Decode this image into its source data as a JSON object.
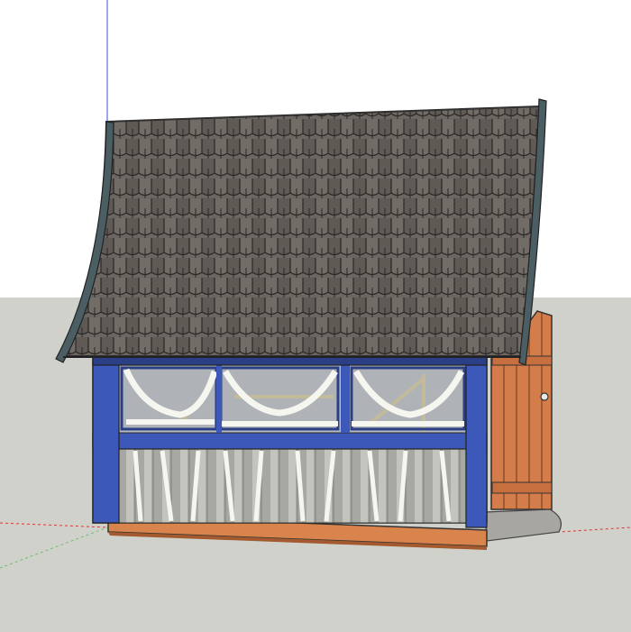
{
  "viewport": {
    "sky_color": "#ffffff",
    "ground_color": "#d1d1cb",
    "axis_colors": {
      "green": "#6fbf6f",
      "blue": "#3a4fd8",
      "red": "#d43b3b"
    }
  },
  "model": {
    "icon": "timber-frame-cottage-model",
    "colors": {
      "roof_shingle": "#6b6661",
      "roof_shingle_dark": "#4e4a45",
      "roof_edge": "#2f2f2f",
      "fascia": "#4a5e63",
      "frame_blue": "#3c58b8",
      "frame_blue_dark": "#2b3f86",
      "infill_white": "#f6f6f0",
      "window_glass": "#b8bcc0",
      "window_glass_dark": "#8e9296",
      "timber_yellow": "#e6d07a",
      "slat_grey": "#a8a8a3",
      "plank_orange": "#d9844d",
      "plank_dark": "#a35a2e",
      "door_wood": "#d47c4a",
      "base_stone": "#a7a6a2"
    }
  }
}
